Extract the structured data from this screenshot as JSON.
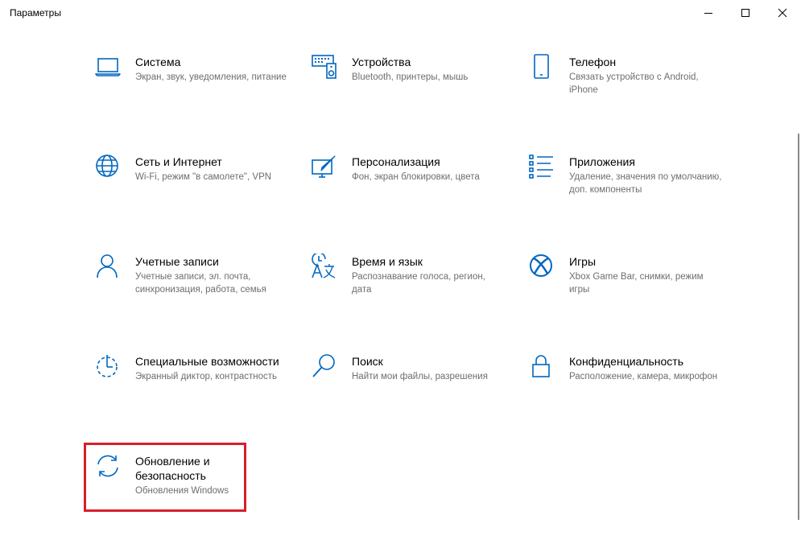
{
  "window": {
    "title": "Параметры",
    "accent_color": "#0067c0",
    "highlight_color": "#d61f2b"
  },
  "controls": {
    "minimize_icon": "minimize-icon",
    "maximize_icon": "maximize-icon",
    "close_icon": "close-icon"
  },
  "tiles": [
    {
      "name": "Система",
      "desc": "Экран, звук, уведомления, питание",
      "icon": "laptop-icon"
    },
    {
      "name": "Устройства",
      "desc": "Bluetooth, принтеры, мышь",
      "icon": "devices-icon"
    },
    {
      "name": "Телефон",
      "desc": "Связать устройство с Android, iPhone",
      "icon": "phone-icon"
    },
    {
      "name": "Сеть и Интернет",
      "desc": "Wi-Fi, режим \"в самолете\", VPN",
      "icon": "globe-icon"
    },
    {
      "name": "Персонализация",
      "desc": "Фон, экран блокировки, цвета",
      "icon": "personalization-icon"
    },
    {
      "name": "Приложения",
      "desc": "Удаление, значения по умолчанию, доп. компоненты",
      "icon": "apps-list-icon"
    },
    {
      "name": "Учетные записи",
      "desc": "Учетные записи, эл. почта, синхронизация, работа, семья",
      "icon": "person-icon"
    },
    {
      "name": "Время и язык",
      "desc": "Распознавание голоса, регион, дата",
      "icon": "time-language-icon"
    },
    {
      "name": "Игры",
      "desc": "Xbox Game Bar, снимки, режим игры",
      "icon": "xbox-icon"
    },
    {
      "name": "Специальные возможности",
      "desc": "Экранный диктор, контрастность",
      "icon": "accessibility-icon"
    },
    {
      "name": "Поиск",
      "desc": "Найти мои файлы, разрешения",
      "icon": "search-icon"
    },
    {
      "name": "Конфиденциальность",
      "desc": "Расположение, камера, микрофон",
      "icon": "lock-icon"
    },
    {
      "name": "Обновление и безопасность",
      "desc": "Обновления Windows",
      "icon": "sync-icon"
    }
  ]
}
